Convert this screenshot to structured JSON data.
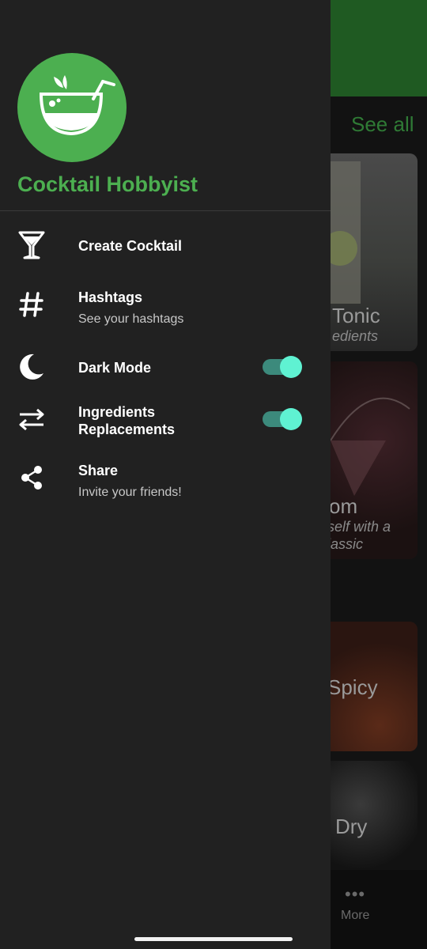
{
  "background": {
    "see_all": "See all",
    "cards": [
      {
        "title": "Tonic",
        "subtitle": "edients"
      },
      {
        "title": "om",
        "subtitle": "self with a\nlassic"
      },
      {
        "title": "Spicy",
        "subtitle": ""
      },
      {
        "title": "Dry",
        "subtitle": ""
      }
    ],
    "more_label": "More",
    "more_dots": "•••"
  },
  "drawer": {
    "app_name": "Cocktail Hobbyist",
    "items": [
      {
        "label": "Create Cocktail",
        "icon": "cocktail-glass-icon"
      },
      {
        "label": "Hashtags",
        "sub": "See your hashtags",
        "icon": "hashtag-icon"
      },
      {
        "label": "Dark Mode",
        "icon": "moon-icon",
        "toggle_on": true
      },
      {
        "label": "Ingredients\nReplacements",
        "icon": "swap-arrows-icon",
        "toggle_on": true
      },
      {
        "label": "Share",
        "sub": "Invite your friends!",
        "icon": "share-icon"
      }
    ]
  },
  "colors": {
    "brand": "#4caf50",
    "drawer_bg": "#212121",
    "toggle_knob": "#5ff2d2",
    "toggle_track": "#3c8a7c"
  }
}
